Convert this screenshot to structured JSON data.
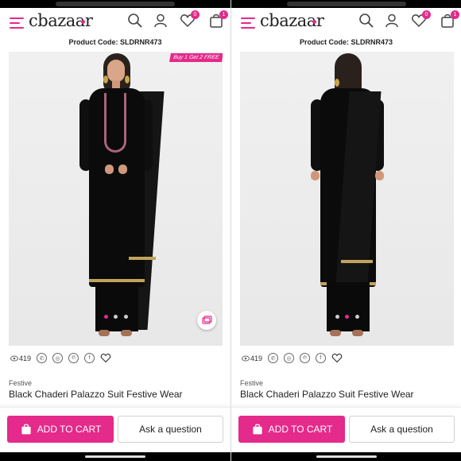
{
  "brand": {
    "logo_text": "cbazaar",
    "accent_color": "#e42a8a"
  },
  "panels": [
    {
      "id": "left",
      "header": {
        "icons": [
          "menu-icon",
          "search-icon",
          "user-icon",
          "heart-icon",
          "bag-icon"
        ],
        "wishlist_count": "0",
        "cart_count": "1"
      },
      "product_code": "Product Code: SLDRNR473",
      "promo_badge": "Buy 1 Get 2 FREE",
      "view": "front",
      "carousel": {
        "total": 3,
        "active": 0
      },
      "views_count": "419",
      "category": "Festive",
      "title": "Black Chaderi Palazzo Suit Festive Wear",
      "add_to_cart": "ADD TO CART",
      "ask_question": "Ask a question"
    },
    {
      "id": "right",
      "header": {
        "icons": [
          "menu-icon",
          "search-icon",
          "user-icon",
          "heart-icon",
          "bag-icon"
        ],
        "wishlist_count": "0",
        "cart_count": "1"
      },
      "product_code": "Product Code: SLDRNR473",
      "view": "back",
      "carousel": {
        "total": 3,
        "active": 1
      },
      "views_count": "419",
      "category": "Festive",
      "title": "Black Chaderi Palazzo Suit Festive Wear",
      "add_to_cart": "ADD TO CART",
      "ask_question": "Ask a question"
    }
  ],
  "social_icons": [
    "eye-icon",
    "whatsapp-icon",
    "instagram-icon",
    "pinterest-icon",
    "facebook-icon",
    "heart-outline-icon"
  ]
}
